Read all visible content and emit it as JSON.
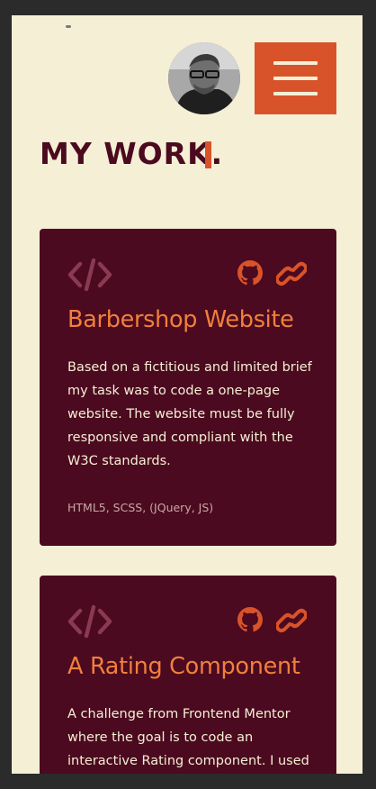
{
  "header": {
    "avatar_alt": "Profile photo",
    "menu_icon": "hamburger-icon"
  },
  "main": {
    "title": "MY WORK.",
    "projects": [
      {
        "title": "Barbershop Website",
        "description": "Based on a fictitious and limited brief my task was to code a one-page website. The website must be fully responsive and compliant with the W3C standards.",
        "tags": "HTML5, SCSS, (JQuery, JS)",
        "icons": [
          "code-icon",
          "github-icon",
          "link-icon"
        ]
      },
      {
        "title": "A Rating Component",
        "description": "A challenge from Frontend Mentor where the goal is to code an interactive Rating component. I used",
        "icons": [
          "code-icon",
          "github-icon",
          "link-icon"
        ]
      }
    ]
  },
  "colors": {
    "background": "#f5efd6",
    "accent": "#d9532a",
    "card": "#4b0a1f",
    "card_title": "#f0803c",
    "code_icon": "#8a3a52"
  }
}
